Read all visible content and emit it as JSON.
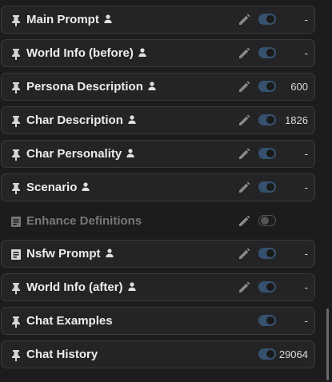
{
  "accent": "#36516e",
  "rows": [
    {
      "label": "Main Prompt",
      "type_icon": "pin-icon",
      "person": true,
      "edit": true,
      "enabled": true,
      "tokens": "-"
    },
    {
      "label": "World Info (before)",
      "type_icon": "pin-icon",
      "person": true,
      "edit": true,
      "enabled": true,
      "tokens": "-"
    },
    {
      "label": "Persona Description",
      "type_icon": "pin-icon",
      "person": true,
      "edit": true,
      "enabled": true,
      "tokens": "600"
    },
    {
      "label": "Char Description",
      "type_icon": "pin-icon",
      "person": true,
      "edit": true,
      "enabled": true,
      "tokens": "1826"
    },
    {
      "label": "Char Personality",
      "type_icon": "pin-icon",
      "person": true,
      "edit": true,
      "enabled": true,
      "tokens": "-"
    },
    {
      "label": "Scenario",
      "type_icon": "pin-icon",
      "person": true,
      "edit": true,
      "enabled": true,
      "tokens": "-"
    },
    {
      "label": "Enhance Definitions",
      "type_icon": "document-icon",
      "person": false,
      "edit": true,
      "enabled": false,
      "tokens": ""
    },
    {
      "label": "Nsfw Prompt",
      "type_icon": "document-icon",
      "person": true,
      "edit": true,
      "enabled": true,
      "tokens": "-"
    },
    {
      "label": "World Info (after)",
      "type_icon": "pin-icon",
      "person": true,
      "edit": true,
      "enabled": true,
      "tokens": "-"
    },
    {
      "label": "Chat Examples",
      "type_icon": "pin-icon",
      "person": false,
      "edit": false,
      "enabled": true,
      "tokens": "-"
    },
    {
      "label": "Chat History",
      "type_icon": "pin-icon",
      "person": false,
      "edit": false,
      "enabled": true,
      "tokens": "29064"
    }
  ]
}
